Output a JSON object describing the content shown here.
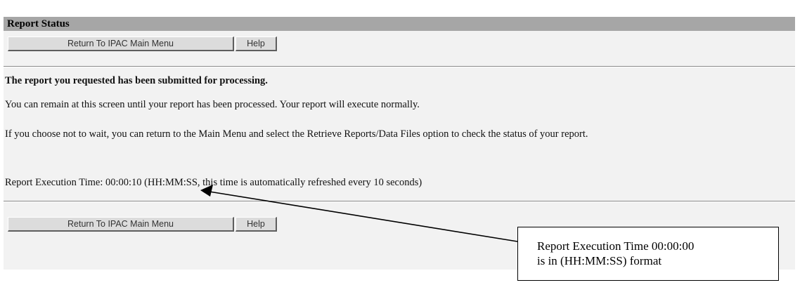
{
  "header": {
    "title": "Report Status"
  },
  "toolbar_top": {
    "return_label": "Return To IPAC Main Menu",
    "help_label": "Help"
  },
  "main": {
    "heading": "The report you requested has been submitted for processing.",
    "paragraph1": "You can remain at this screen until your report has been processed. Your report will execute normally.",
    "paragraph2": "If you choose not to wait, you can return to the Main Menu and select the Retrieve Reports/Data Files option to check the status of your report.",
    "execution_time_line": "Report Execution Time: 00:00:10 (HH:MM:SS, this time is automatically refreshed every 10 seconds)"
  },
  "toolbar_bottom": {
    "return_label": "Return To IPAC Main Menu",
    "help_label": "Help"
  },
  "callout": {
    "line1": "Report Execution Time 00:00:00",
    "line2": "is in (HH:MM:SS) format"
  },
  "colors": {
    "title_bar": "#a6a6a6",
    "panel_background": "#f2f2f2",
    "button_face": "#dcdcdc"
  }
}
